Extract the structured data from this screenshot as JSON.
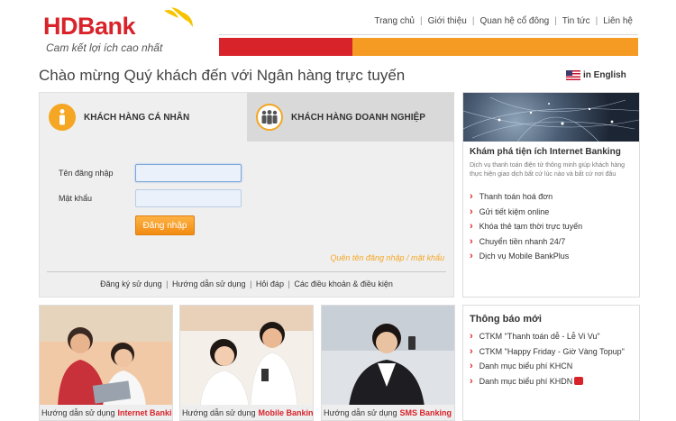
{
  "header": {
    "logo_text": "HDBank",
    "logo_slogan": "Cam kết lợi ích cao nhất",
    "nav": [
      "Trang chủ",
      "Giới thiệu",
      "Quan hệ cổ đông",
      "Tin tức",
      "Liên hệ"
    ]
  },
  "welcome": "Chào mừng Quý khách đến với Ngân hàng trực tuyến",
  "language": "in English",
  "login": {
    "tab_personal": "KHÁCH HÀNG CÁ NHÂN",
    "tab_business": "KHÁCH HÀNG DOANH NGHIỆP",
    "username_label": "Tên đăng nhập",
    "password_label": "Mật khẩu",
    "username_value": "",
    "password_value": "",
    "login_button": "Đăng nhập",
    "forgot_link": "Quên tên đăng nhập / mật khẩu",
    "footer_links": [
      "Đăng ký sử dụng",
      "Hướng dẫn sử dụng",
      "Hỏi đáp",
      "Các điều khoản & điều kiện"
    ]
  },
  "explore": {
    "title": "Khám phá tiện ích Internet Banking",
    "description": "Dịch vụ thanh toán điện tử thông minh giúp khách hàng thực hiện giao dịch bất cứ lúc nào và bất cứ nơi đâu",
    "items": [
      "Thanh toán hoá đơn",
      "Gửi tiết kiệm online",
      "Khóa thẻ tạm thời trực tuyến",
      "Chuyển tiền nhanh 24/7",
      "Dịch vụ Mobile BankPlus"
    ]
  },
  "notices": {
    "title": "Thông báo mới",
    "items": [
      "CTKM \"Thanh toán dễ - Lễ Vi Vu\"",
      "CTKM \"Happy Friday - Giờ Vàng Topup\"",
      "Danh mục biểu phí KHCN",
      "Danh mục biểu phí KHDN"
    ]
  },
  "cards": [
    {
      "prefix": "Hướng dẫn sử dụng",
      "highlight": "Internet Banking"
    },
    {
      "prefix": "Hướng dẫn sử dụng",
      "highlight": "Mobile Banking"
    },
    {
      "prefix": "Hướng dẫn sử dụng",
      "highlight": "SMS Banking"
    }
  ],
  "colors": {
    "brand_red": "#d8232a",
    "brand_orange": "#f59a23"
  }
}
